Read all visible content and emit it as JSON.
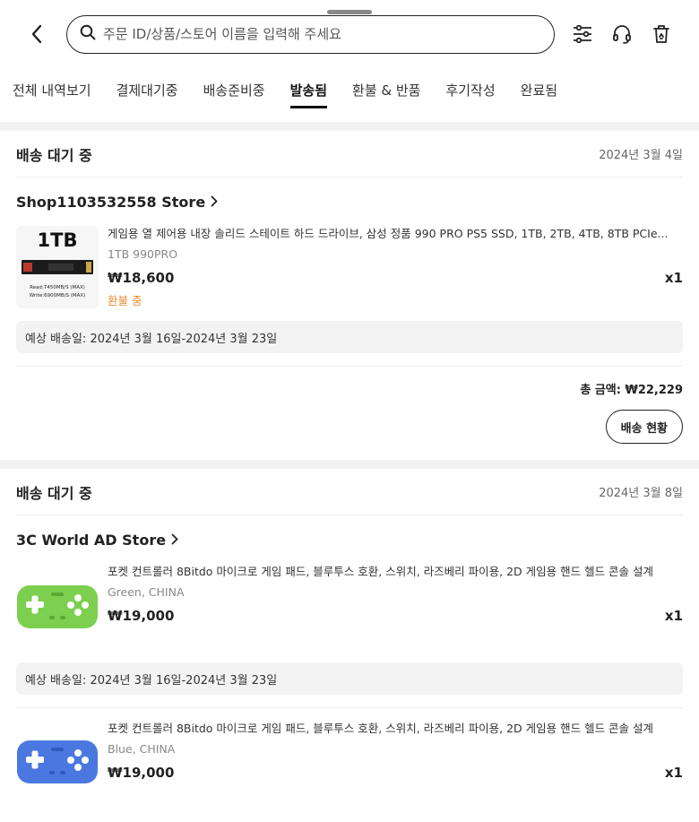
{
  "search": {
    "placeholder": "주문 ID/상품/스토어 이름을 입력해 주세요"
  },
  "tabs": [
    {
      "label": "전체 내역보기"
    },
    {
      "label": "결제대기중"
    },
    {
      "label": "배송준비중"
    },
    {
      "label": "발송됨",
      "active": true
    },
    {
      "label": "환불 & 반품"
    },
    {
      "label": "후기작성"
    },
    {
      "label": "완료됨"
    }
  ],
  "orders": [
    {
      "status": "배송 대기 중",
      "date": "2024년 3월 4일",
      "store": "Shop1103532558 Store",
      "items": [
        {
          "title": "게임용 열 제어용 내장 솔리드 스테이트 하드 드라이브, 삼성 정품 990 PRO PS5 SSD, 1TB, 2TB, 4TB, 8TB PCIe...",
          "variant": "1TB 990PRO",
          "price": "₩18,600",
          "qty": "x1",
          "note": "환불 중",
          "thumb": {
            "capacity": "1TB",
            "spec1": "Read:7450MB/S (MAX)",
            "spec2": "Write:6900MB/S (MAX)"
          }
        }
      ],
      "eta": "예상 배송일: 2024년 3월 16일-2024년 3월 23일",
      "total": "총 금액: ₩22,229",
      "button": "배송 현황"
    },
    {
      "status": "배송 대기 중",
      "date": "2024년 3월 8일",
      "store": "3C World AD Store",
      "items": [
        {
          "title": "포켓 컨트롤러 8Bitdo 마이크로 게임 패드, 블루투스 호환, 스위치, 라즈베리 파이용, 2D 게임용 핸드 헬드 콘솔 설계",
          "variant": "Green, CHINA",
          "price": "₩19,000",
          "qty": "x1",
          "eta": "예상 배송일: 2024년 3월 16일-2024년 3월 23일",
          "color": "#7ccf4f"
        },
        {
          "title": "포켓 컨트롤러 8Bitdo 마이크로 게임 패드, 블루투스 호환, 스위치, 라즈베리 파이용, 2D 게임용 핸드 헬드 콘솔 설계",
          "variant": "Blue, CHINA",
          "price": "₩19,000",
          "qty": "x1",
          "color": "#4a78e0"
        }
      ]
    }
  ]
}
